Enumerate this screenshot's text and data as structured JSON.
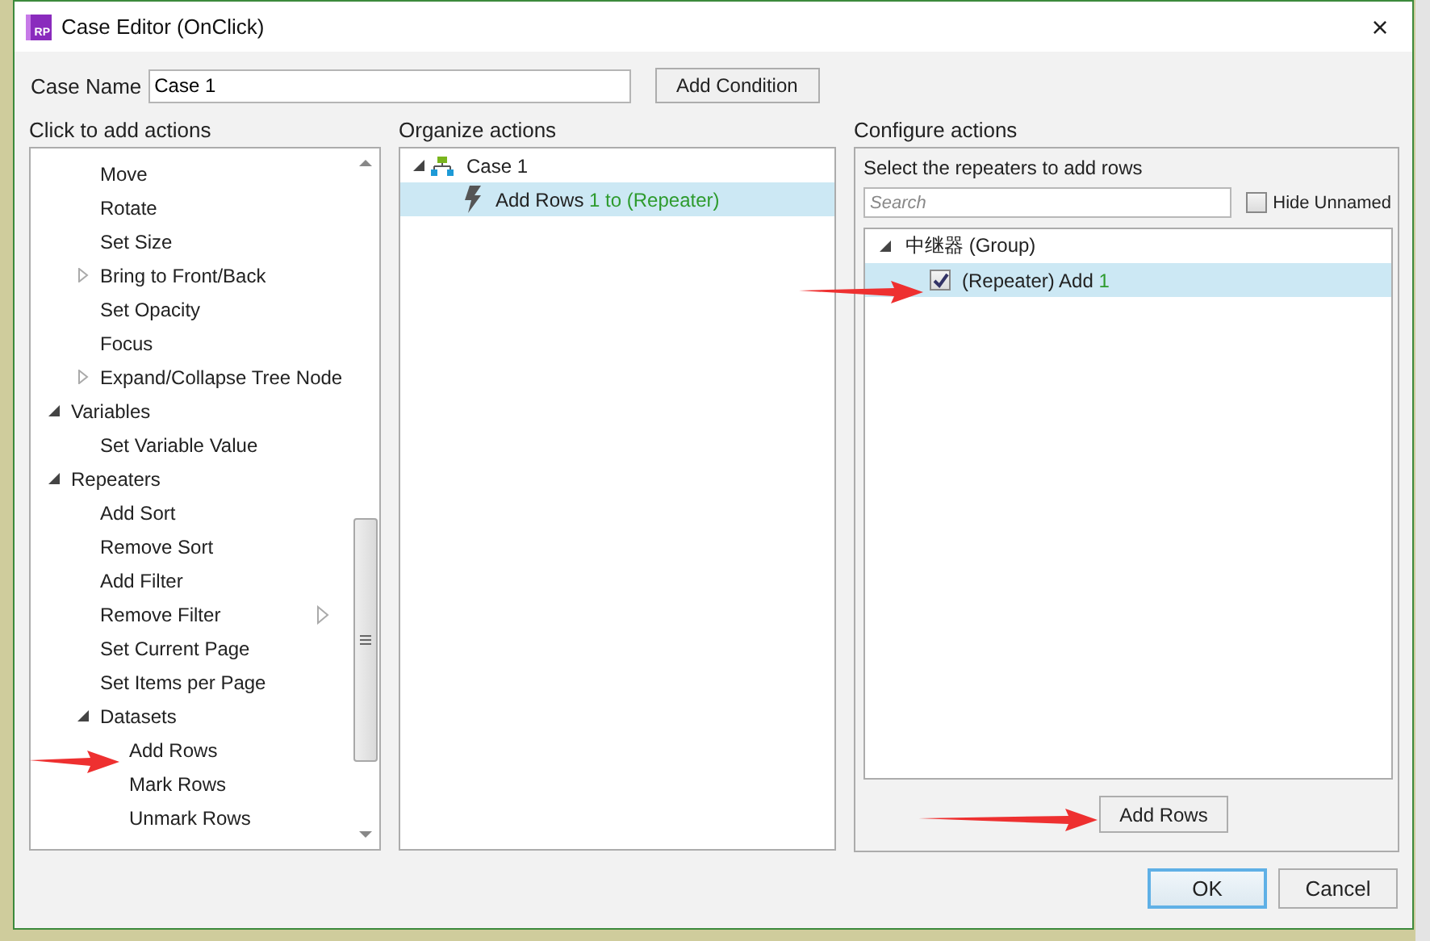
{
  "window": {
    "title": "Case Editor (OnClick)",
    "app_icon": "RP",
    "close": "×"
  },
  "case_name": {
    "label": "Case Name",
    "value": "Case 1"
  },
  "add_condition": "Add Condition",
  "actions_panel": {
    "heading": "Click to add actions",
    "items": [
      {
        "label": "Move",
        "kind": "leaf",
        "flyout": false
      },
      {
        "label": "Rotate",
        "kind": "leaf",
        "flyout": false
      },
      {
        "label": "Set Size",
        "kind": "leaf",
        "flyout": false
      },
      {
        "label": "Bring to Front/Back",
        "kind": "node",
        "expanded": false,
        "flyout": false
      },
      {
        "label": "Set Opacity",
        "kind": "leaf",
        "flyout": false
      },
      {
        "label": "Focus",
        "kind": "leaf",
        "flyout": false
      },
      {
        "label": "Expand/Collapse Tree Node",
        "kind": "node",
        "expanded": false,
        "flyout": false
      }
    ],
    "groups": [
      {
        "label": "Variables",
        "kind": "node",
        "expanded": true,
        "children": [
          {
            "label": "Set Variable Value",
            "kind": "leaf",
            "flyout": false
          }
        ]
      },
      {
        "label": "Repeaters",
        "kind": "node",
        "expanded": true,
        "children": [
          {
            "label": "Add Sort",
            "kind": "leaf",
            "flyout": false
          },
          {
            "label": "Remove Sort",
            "kind": "leaf",
            "flyout": false
          },
          {
            "label": "Add Filter",
            "kind": "leaf",
            "flyout": false
          },
          {
            "label": "Remove Filter",
            "kind": "leaf",
            "flyout": true
          },
          {
            "label": "Set Current Page",
            "kind": "leaf",
            "flyout": false
          },
          {
            "label": "Set Items per Page",
            "kind": "leaf",
            "flyout": false
          },
          {
            "label": "Datasets",
            "kind": "node",
            "expanded": true,
            "flyout": false,
            "children": [
              {
                "label": "Add Rows",
                "kind": "leaf",
                "flyout": false
              },
              {
                "label": "Mark Rows",
                "kind": "leaf",
                "flyout": false
              },
              {
                "label": "Unmark Rows",
                "kind": "leaf",
                "flyout": false
              }
            ]
          }
        ]
      }
    ]
  },
  "organize_panel": {
    "heading": "Organize actions",
    "tree": [
      {
        "label": "Case 1",
        "expanded": true,
        "children": [
          {
            "label": "Add Rows",
            "detail": "1 to (Repeater)",
            "selected": true
          }
        ]
      }
    ]
  },
  "configure_panel": {
    "heading": "Configure actions",
    "prompt": "Select the repeaters to add rows",
    "search": {
      "placeholder": "Search"
    },
    "hide_unnamed": {
      "label": "Hide Unnamed",
      "checked": false
    },
    "tree": [
      {
        "label": "中继器 (Group)",
        "expanded": true,
        "children": [
          {
            "label": "(Repeater) Add",
            "detail": "1",
            "checked": true,
            "selected": true
          }
        ]
      }
    ],
    "action_button": "Add Rows"
  },
  "buttons": [
    {
      "label": "OK",
      "default": true
    },
    {
      "label": "Cancel",
      "default": false
    }
  ]
}
